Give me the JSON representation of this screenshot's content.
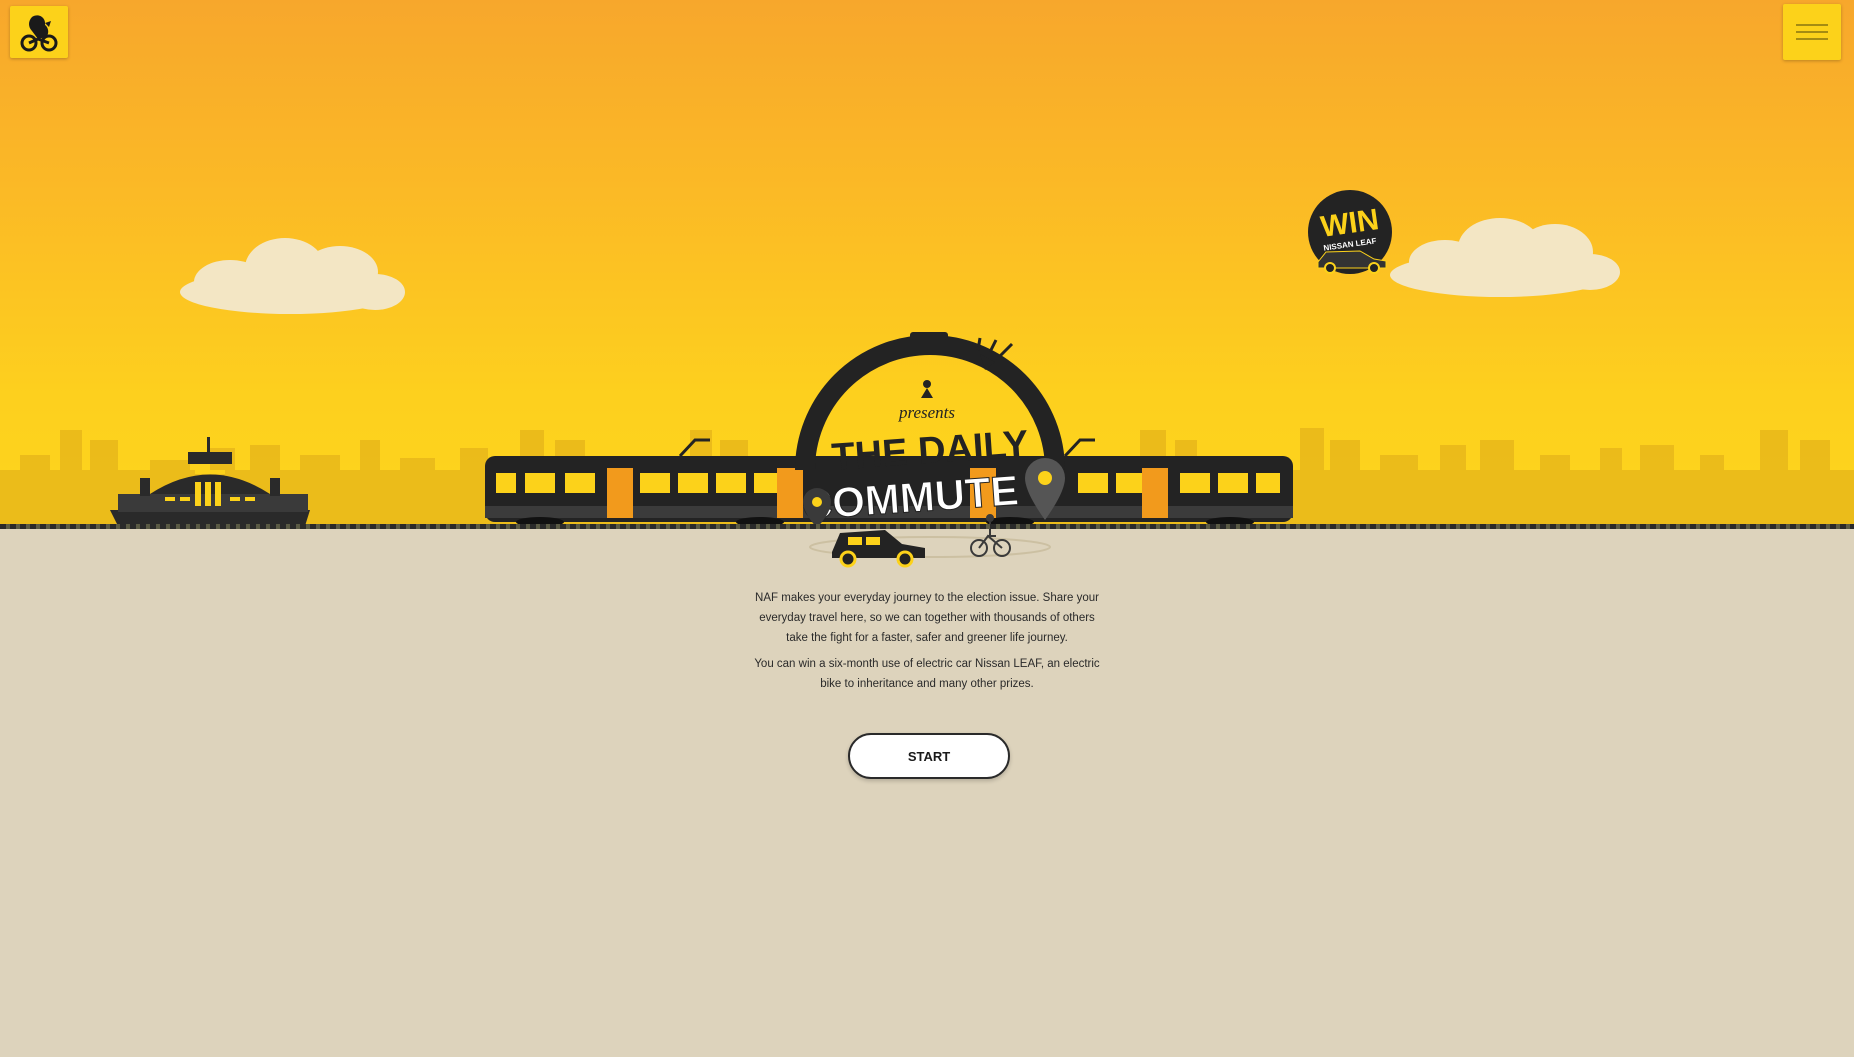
{
  "header": {
    "logo_icon": "lion-on-bicycle-logo-icon",
    "menu_icon": "hamburger-menu-icon"
  },
  "hero": {
    "presents": "presents",
    "title_line1": "THE DAILY",
    "title_line2": "COMMUTE",
    "badge_line1": "WIN",
    "badge_line2": "NISSAN LEAF"
  },
  "intro": {
    "paragraph1": "NAF makes your everyday journey to the election issue. Share your everyday travel here, so we can together with thousands of others take the fight for a faster, safer and greener life journey.",
    "paragraph2": "You can win a six-month use of electric car Nissan LEAF, an electric bike to inheritance and many other prizes."
  },
  "cta": {
    "start_label": "START"
  },
  "colors": {
    "sky_top": "#f7a72c",
    "sky_bottom": "#fdd51c",
    "ground": "#ddd3bc",
    "brand_yellow": "#fcd21a",
    "dark": "#2a2a2a",
    "accent_orange": "#f29a1c"
  }
}
